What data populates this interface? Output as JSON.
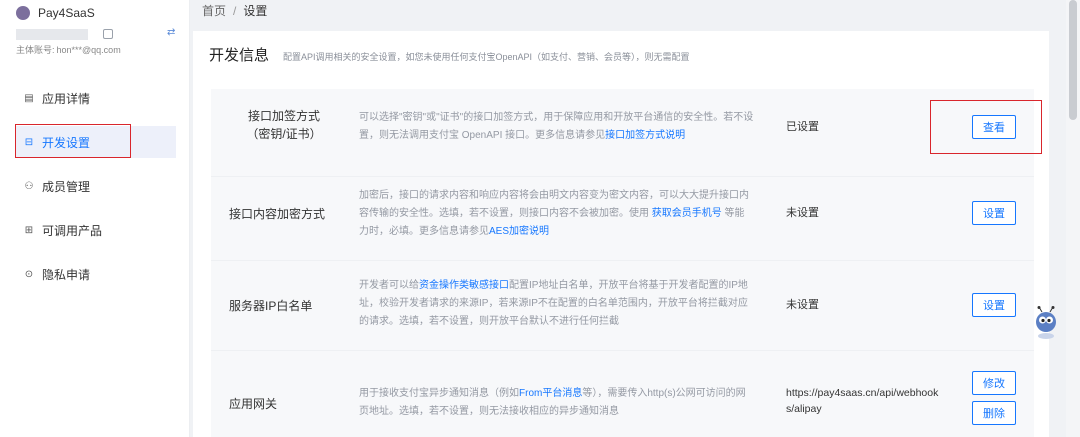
{
  "brand": {
    "name": "Pay4SaaS"
  },
  "account": {
    "label": "主体账号:",
    "email": "hon***@qq.com"
  },
  "sidebar": {
    "items": [
      {
        "label": "应用详情",
        "icon": "app-detail-icon",
        "glyph": "▤"
      },
      {
        "label": "开发设置",
        "icon": "dev-settings-icon",
        "glyph": "⊟"
      },
      {
        "label": "成员管理",
        "icon": "members-icon",
        "glyph": "⚇"
      },
      {
        "label": "可调用产品",
        "icon": "products-icon",
        "glyph": "⊞"
      },
      {
        "label": "隐私申请",
        "icon": "privacy-icon",
        "glyph": "⊙"
      }
    ]
  },
  "breadcrumb": {
    "home": "首页",
    "sep": "/",
    "current": "设置"
  },
  "card": {
    "title": "开发信息",
    "desc": "配置API调用相关的安全设置，如您未使用任何支付宝OpenAPI（如支付、营销、会员等），则无需配置"
  },
  "rows": [
    {
      "title_line1": "接口加签方式",
      "title_line2": "（密钥/证书）",
      "desc_text": "可以选择\"密钥\"或\"证书\"的接口加签方式，用于保障应用和开放平台通信的安全性。若不设置，则无法调用支付宝 OpenAPI 接口。更多信息请参见",
      "desc_link": "接口加签方式说明",
      "status": "已设置",
      "button": "查看"
    },
    {
      "title_line1": "接口内容加密方式",
      "desc_text": "加密后，接口的请求内容和响应内容将会由明文内容变为密文内容，可以大大提升接口内容传输的安全性。选填，若不设置，则接口内容不会被加密。使用 ",
      "desc_link": "获取会员手机号",
      "desc_text2": " 等能力时，必填。更多信息请参见",
      "desc_link2": "AES加密说明",
      "status": "未设置",
      "button": "设置"
    },
    {
      "title_line1": "服务器IP白名单",
      "desc_text": "开发者可以给",
      "desc_link": "资金操作类敏感接口",
      "desc_text2": "配置IP地址白名单，开放平台将基于开发者配置的IP地址，校验开发者请求的来源IP，若来源IP不在配置的白名单范围内，开放平台将拦截对应的请求。选填，若不设置，则开放平台默认不进行任何拦截",
      "status": "未设置",
      "button": "设置"
    },
    {
      "title_line1": "应用网关",
      "desc_text": "用于接收支付宝异步通知消息（例如",
      "desc_link": "From平台消息",
      "desc_text2": "等），需要传入http(s)公网可访问的网页地址。选填，若不设置，则无法接收相应的异步通知消息",
      "status": "https://pay4saas.cn/api/webhooks/alipay",
      "button": "修改",
      "button2": "删除"
    }
  ],
  "colors": {
    "accent": "#1677ff",
    "highlight_border": "#d9262c"
  }
}
